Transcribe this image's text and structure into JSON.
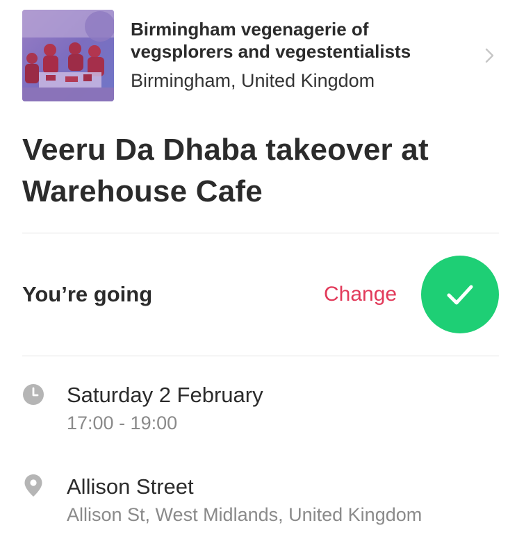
{
  "group": {
    "name": "Birmingham vegenagerie of vegsplorers and vegestentialists",
    "location": "Birmingham, United Kingdom",
    "chevron_icon": "chevron-right-icon"
  },
  "event": {
    "title": "Veeru Da Dhaba takeover at Warehouse Cafe"
  },
  "rsvp": {
    "status": "You’re going",
    "change_label": "Change",
    "check_icon": "checkmark-icon"
  },
  "time": {
    "icon": "clock-icon",
    "date": "Saturday 2 February",
    "range": "17:00 - 19:00"
  },
  "venue": {
    "icon": "map-pin-icon",
    "name": "Allison Street",
    "address": "Allison St, West Midlands, United Kingdom"
  },
  "colors": {
    "accent_red": "#e23a5a",
    "going_green": "#1ecf75",
    "muted_text": "#8a8a8a",
    "icon_gray": "#b5b5b5"
  }
}
